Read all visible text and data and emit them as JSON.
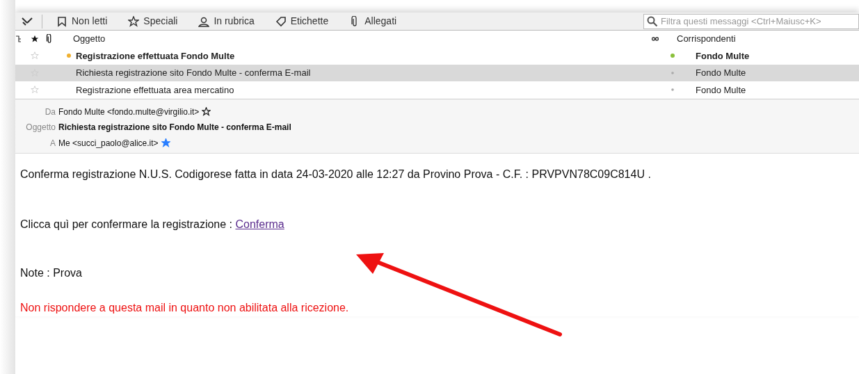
{
  "toolbar": {
    "filters": [
      {
        "label": "Non letti"
      },
      {
        "label": "Speciali"
      },
      {
        "label": "In rubrica"
      },
      {
        "label": "Etichette"
      },
      {
        "label": "Allegati"
      }
    ],
    "search": {
      "placeholder": "Filtra questi messaggi <Ctrl+Maiusc+K>"
    }
  },
  "message_list": {
    "columns": {
      "subject": "Oggetto",
      "correspondents": "Corrispondenti"
    },
    "rows": [
      {
        "subject": "Registrazione effettuata Fondo Multe",
        "correspondent": "Fondo Multe",
        "unread": true,
        "selected": false,
        "starred": false
      },
      {
        "subject": "Richiesta registrazione sito Fondo Multe - conferma E-mail",
        "correspondent": "Fondo Multe",
        "unread": false,
        "selected": true,
        "starred": false
      },
      {
        "subject": "Registrazione effettuata area mercatino",
        "correspondent": "Fondo Multe",
        "unread": false,
        "selected": false,
        "starred": false
      }
    ]
  },
  "header": {
    "from": {
      "label": "Da",
      "value": "Fondo Multe <fondo.multe@virgilio.it>",
      "starred": false
    },
    "subject": {
      "label": "Oggetto",
      "value": "Richiesta registrazione sito Fondo Multe - conferma E-mail"
    },
    "to": {
      "label": "A",
      "value": "Me <succi_paolo@alice.it>",
      "starred": true
    }
  },
  "body": {
    "paragraphs": [
      {
        "kind": "text",
        "text": "Conferma registrazione N.U.S. Codigorese fatta in data 24-03-2020 alle 12:27 da Provino Prova - C.F. : PRVPVN78C09C814U ."
      },
      {
        "kind": "link",
        "text": "Clicca quì per confermare la registrazione :",
        "link": "Conferma"
      },
      {
        "kind": "text",
        "text": "Note : Prova"
      },
      {
        "kind": "warning",
        "text": "Non rispondere a questa mail in quanto non abilitata alla ricezione."
      }
    ]
  }
}
